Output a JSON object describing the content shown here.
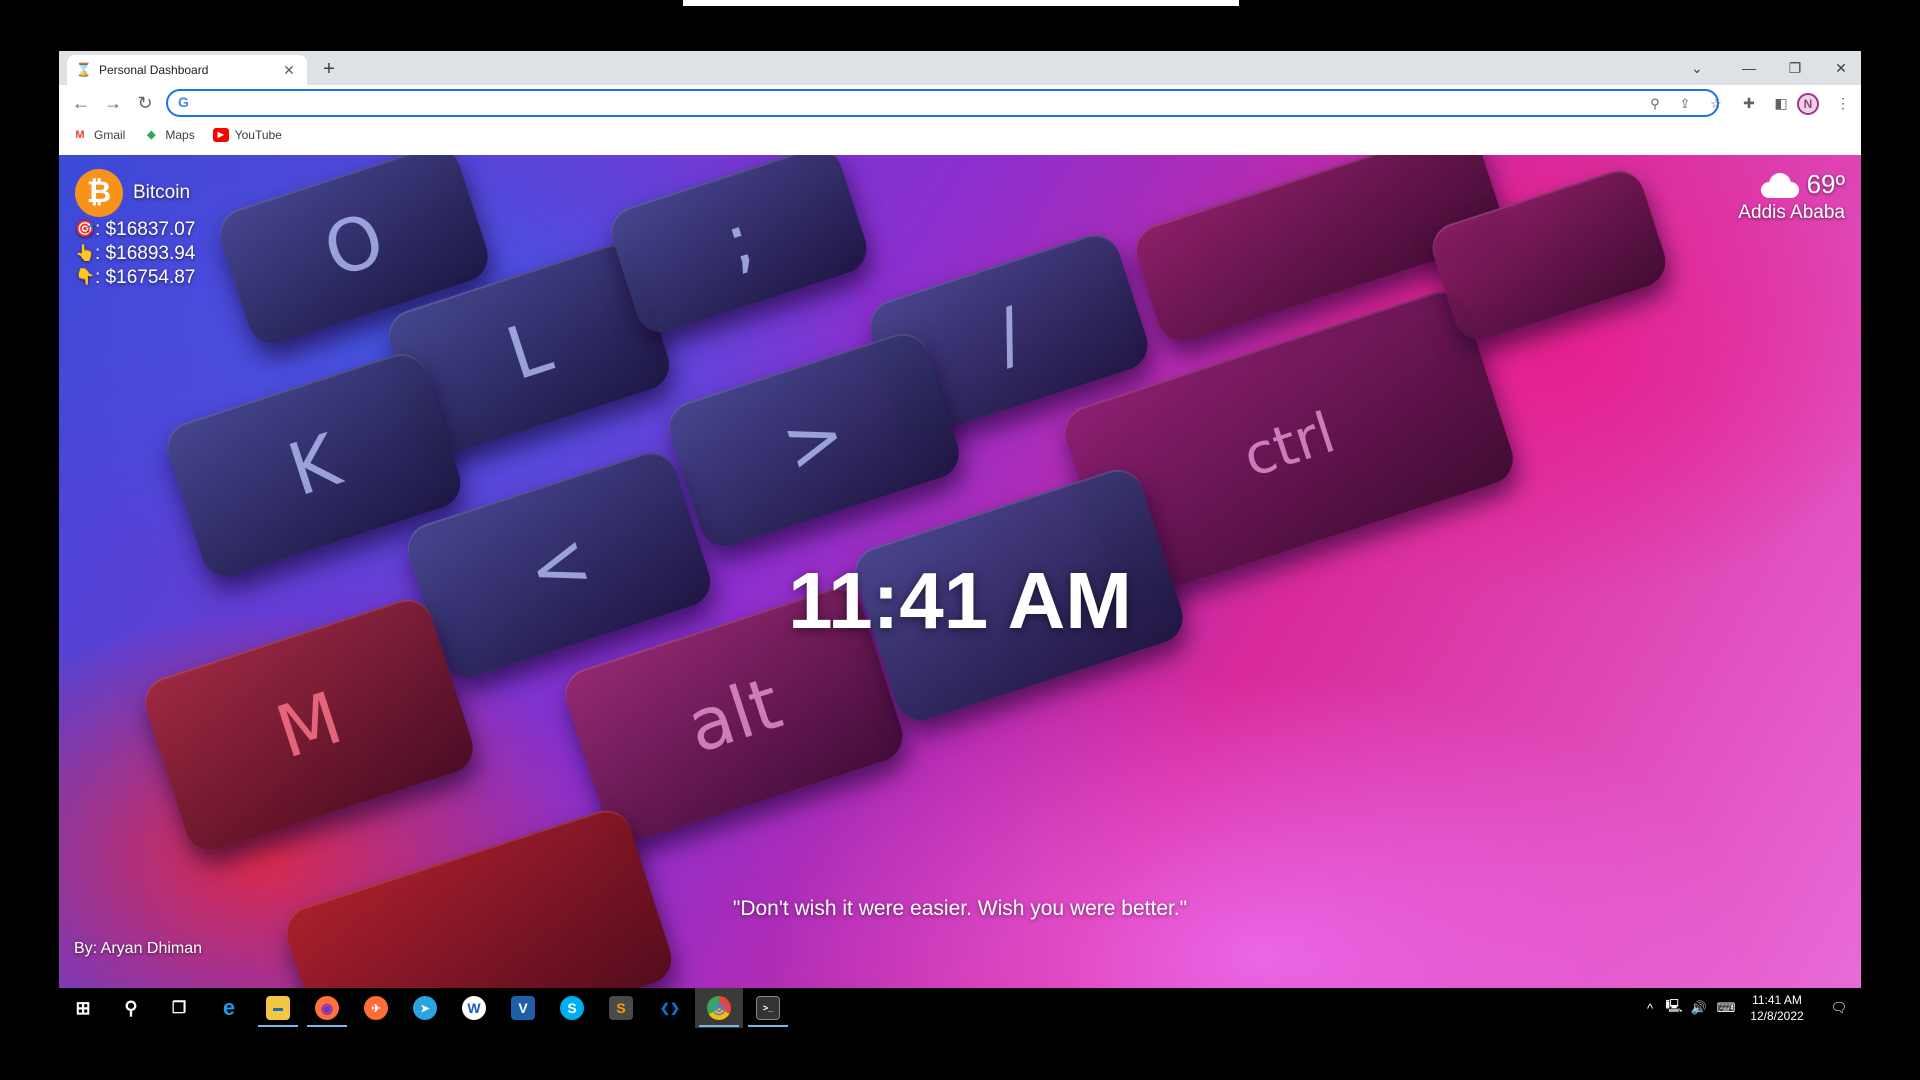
{
  "browser": {
    "tab_title": "Personal Dashboard",
    "new_tab_label": "+",
    "address_value": "",
    "bookmarks": [
      {
        "label": "Gmail",
        "icon": "gmail-icon",
        "color": "#ea4335"
      },
      {
        "label": "Maps",
        "icon": "maps-icon",
        "color": "#34a853"
      },
      {
        "label": "YouTube",
        "icon": "youtube-icon",
        "color": "#ff0000"
      }
    ],
    "profile_initial": "N"
  },
  "dashboard": {
    "crypto": {
      "name": "Bitcoin",
      "logo_symbol": "₿",
      "current": ": $16837.07",
      "high": ": $16893.94",
      "low": ": $16754.87"
    },
    "weather": {
      "temperature": "69º",
      "city": "Addis Ababa",
      "icon": "partly-cloudy-icon"
    },
    "time": "11:41 AM",
    "quote": "\"Don't wish it were easier. Wish you were better.\"",
    "author": "By: Aryan Dhiman",
    "background_keys": [
      "O",
      "L",
      "K",
      ";",
      "/",
      "?",
      ">",
      "<",
      "M",
      "alt",
      "ctrl"
    ]
  },
  "taskbar": {
    "apps": [
      {
        "name": "edge",
        "icon": "e",
        "color": "#1f9ce6"
      },
      {
        "name": "file-explorer",
        "icon": "▬",
        "color": "#f2c744"
      },
      {
        "name": "firefox",
        "icon": "◉",
        "color": "#ff7139"
      },
      {
        "name": "postman",
        "icon": "✈",
        "color": "#ff6c37"
      },
      {
        "name": "telegram",
        "icon": "➤",
        "color": "#2aa3df"
      },
      {
        "name": "wps",
        "icon": "W",
        "color": "#ffffff"
      },
      {
        "name": "vim",
        "icon": "V",
        "color": "#1f5fa8"
      },
      {
        "name": "skype",
        "icon": "S",
        "color": "#00aff0"
      },
      {
        "name": "sublime",
        "icon": "S",
        "color": "#ff9800"
      },
      {
        "name": "vscode",
        "icon": "❮❯",
        "color": "#0078d4"
      },
      {
        "name": "chrome",
        "icon": "◎",
        "color": "#4285f4"
      },
      {
        "name": "terminal",
        "icon": ">_",
        "color": "#333333"
      }
    ],
    "clock_time": "11:41 AM",
    "clock_date": "12/8/2022"
  },
  "colors": {
    "omnibox_border": "#1a73e8",
    "bitcoin_orange": "#f7931a",
    "taskbar_bg": "#000000"
  }
}
